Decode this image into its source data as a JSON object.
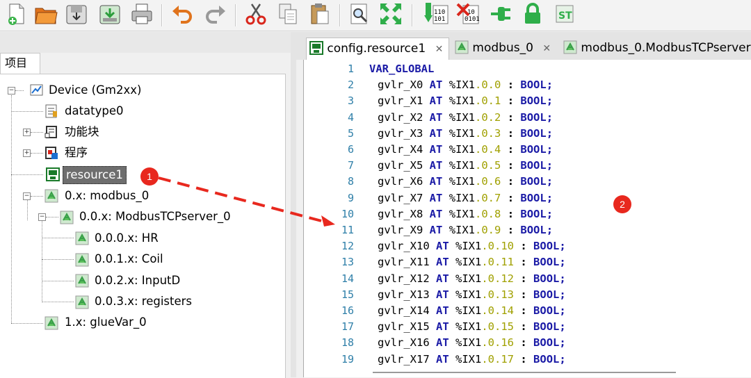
{
  "toolbar": {
    "buttons": [
      {
        "icon": "new-file-icon"
      },
      {
        "icon": "open-folder-icon"
      },
      {
        "icon": "save-icon"
      },
      {
        "icon": "save-as-icon"
      },
      {
        "icon": "print-icon"
      },
      {
        "icon": "undo-icon"
      },
      {
        "icon": "redo-icon"
      },
      {
        "icon": "cut-icon"
      },
      {
        "icon": "copy-icon"
      },
      {
        "icon": "paste-icon"
      },
      {
        "icon": "find-icon"
      },
      {
        "icon": "fullscreen-icon"
      },
      {
        "icon": "download-binary-icon"
      },
      {
        "icon": "clear-binary-icon"
      },
      {
        "icon": "connect-icon"
      },
      {
        "icon": "lock-icon"
      },
      {
        "icon": "debug-st-icon"
      }
    ],
    "binary_top": "110",
    "binary_bottom": "101",
    "clear_top": "10",
    "clear_bottom": "0101",
    "debug_label": "ST"
  },
  "left_panel": {
    "tab_label": "项目",
    "tree": [
      {
        "label": "Device (Gm2xx)"
      },
      {
        "label": "datatype0"
      },
      {
        "label": "功能块"
      },
      {
        "label": "程序"
      },
      {
        "label": "resource1"
      },
      {
        "label": "0.x: modbus_0"
      },
      {
        "label": "0.0.x: ModbusTCPserver_0"
      },
      {
        "label": "0.0.0.x: HR"
      },
      {
        "label": "0.0.1.x: Coil"
      },
      {
        "label": "0.0.2.x: InputD"
      },
      {
        "label": "0.0.3.x: registers"
      },
      {
        "label": "1.x: glueVar_0"
      }
    ]
  },
  "editor": {
    "tabs": [
      {
        "label": "config.resource1",
        "close": "✕"
      },
      {
        "label": "modbus_0",
        "close": "✕"
      },
      {
        "label": "modbus_0.ModbusTCPserver"
      }
    ],
    "header_line": "VAR_GLOBAL",
    "lines": [
      {
        "var": "gvlr_X0",
        "addr_prefix": "%IX1",
        "addr_suffix": ".0.0"
      },
      {
        "var": "gvlr_X1",
        "addr_prefix": "%IX1",
        "addr_suffix": ".0.1"
      },
      {
        "var": "gvlr_X2",
        "addr_prefix": "%IX1",
        "addr_suffix": ".0.2"
      },
      {
        "var": "gvlr_X3",
        "addr_prefix": "%IX1",
        "addr_suffix": ".0.3"
      },
      {
        "var": "gvlr_X4",
        "addr_prefix": "%IX1",
        "addr_suffix": ".0.4"
      },
      {
        "var": "gvlr_X5",
        "addr_prefix": "%IX1",
        "addr_suffix": ".0.5"
      },
      {
        "var": "gvlr_X6",
        "addr_prefix": "%IX1",
        "addr_suffix": ".0.6"
      },
      {
        "var": "gvlr_X7",
        "addr_prefix": "%IX1",
        "addr_suffix": ".0.7"
      },
      {
        "var": "gvlr_X8",
        "addr_prefix": "%IX1",
        "addr_suffix": ".0.8"
      },
      {
        "var": "gvlr_X9",
        "addr_prefix": "%IX1",
        "addr_suffix": ".0.9"
      },
      {
        "var": "gvlr_X10",
        "addr_prefix": "%IX1",
        "addr_suffix": ".0.10"
      },
      {
        "var": "gvlr_X11",
        "addr_prefix": "%IX1",
        "addr_suffix": ".0.11"
      },
      {
        "var": "gvlr_X12",
        "addr_prefix": "%IX1",
        "addr_suffix": ".0.12"
      },
      {
        "var": "gvlr_X13",
        "addr_prefix": "%IX1",
        "addr_suffix": ".0.13"
      },
      {
        "var": "gvlr_X14",
        "addr_prefix": "%IX1",
        "addr_suffix": ".0.14"
      },
      {
        "var": "gvlr_X15",
        "addr_prefix": "%IX1",
        "addr_suffix": ".0.15"
      },
      {
        "var": "gvlr_X16",
        "addr_prefix": "%IX1",
        "addr_suffix": ".0.16"
      },
      {
        "var": "gvlr_X17",
        "addr_prefix": "%IX1",
        "addr_suffix": ".0.17"
      }
    ],
    "line_numbers": [
      "1",
      "2",
      "3",
      "4",
      "5",
      "6",
      "7",
      "8",
      "9",
      "10",
      "11",
      "12",
      "13",
      "14",
      "15",
      "16",
      "17",
      "18",
      "19"
    ],
    "kw_at": "AT",
    "type": "BOOL;",
    "colon": ":"
  },
  "annotations": {
    "badge1": "1",
    "badge2": "2",
    "arrow_color": "#e8281e"
  }
}
